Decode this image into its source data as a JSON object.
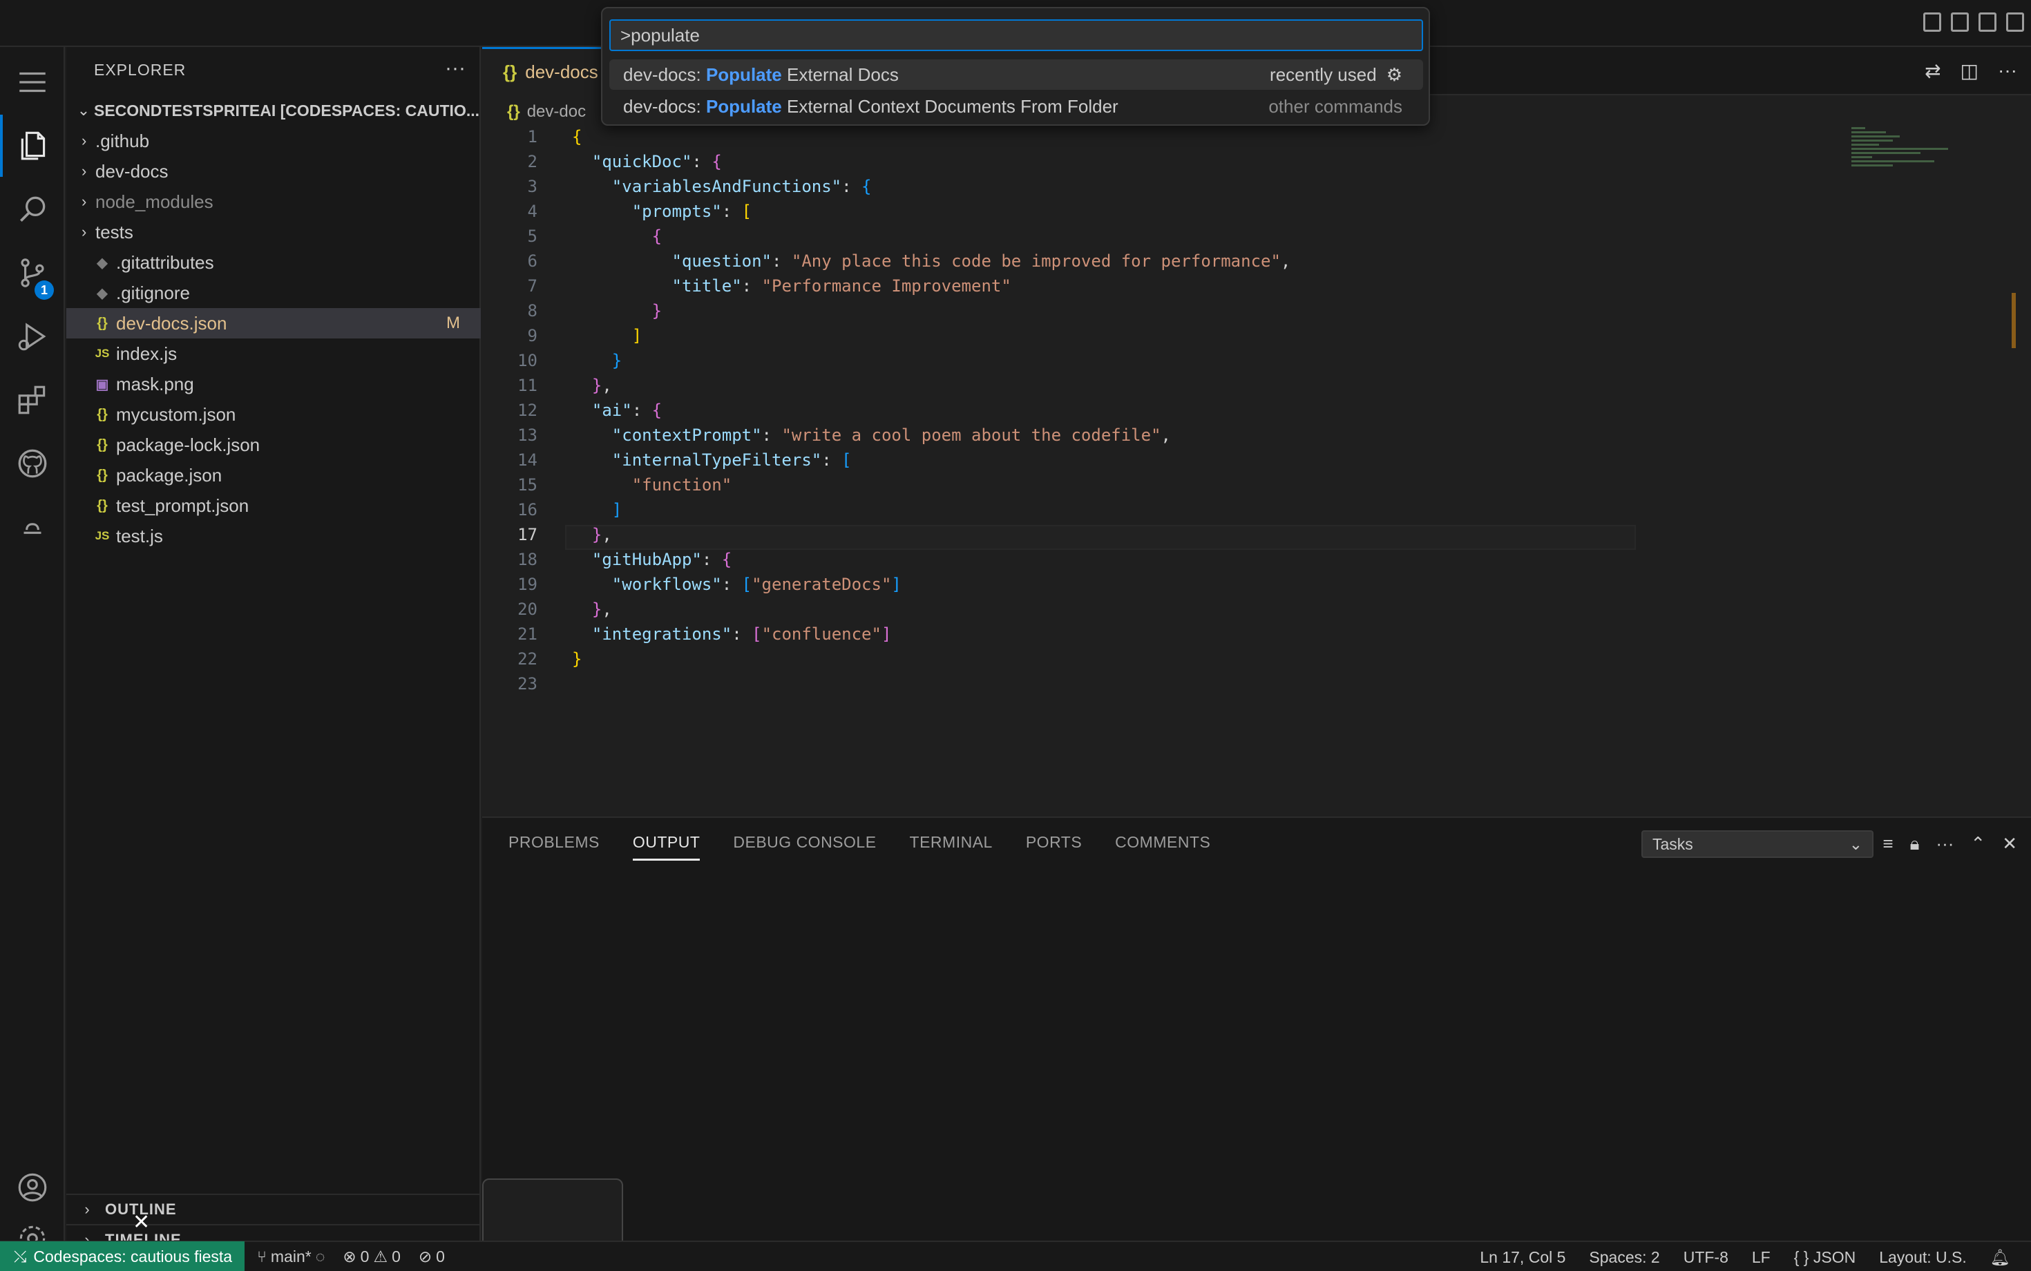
{
  "quick_input": {
    "value": ">populate",
    "items": [
      {
        "prefix": "dev-docs: ",
        "highlight": "Populate",
        "suffix": " External Docs",
        "detail": "recently used"
      },
      {
        "prefix": "dev-docs: ",
        "highlight": "Populate",
        "suffix": " External Context Documents From Folder",
        "detail": "other commands"
      }
    ]
  },
  "activity_bar": {
    "scm_badge": "1"
  },
  "sidebar": {
    "title": "EXPLORER",
    "more": "···",
    "workspace": "SECONDTESTSPRITEAI [CODESPACES: CAUTIO...",
    "folders": [
      ".github",
      "dev-docs",
      "node_modules",
      "tests"
    ],
    "files": [
      ".gitattributes",
      ".gitignore",
      "dev-docs.json",
      "index.js",
      "mask.png",
      "mycustom.json",
      "package-lock.json",
      "package.json",
      "test_prompt.json",
      "test.js"
    ],
    "modified_marker": "M",
    "outline": "OUTLINE",
    "timeline": "TIMELINE"
  },
  "editor": {
    "tab_label": "dev-docs",
    "breadcrumb": "dev-doc",
    "line_numbers": [
      "1",
      "2",
      "3",
      "4",
      "5",
      "6",
      "7",
      "8",
      "9",
      "10",
      "11",
      "12",
      "13",
      "14",
      "15",
      "16",
      "17",
      "18",
      "19",
      "20",
      "21",
      "22",
      "23"
    ]
  },
  "panel": {
    "tabs": [
      "PROBLEMS",
      "OUTPUT",
      "DEBUG CONSOLE",
      "TERMINAL",
      "PORTS",
      "COMMENTS"
    ],
    "active_tab": "OUTPUT",
    "output_channel": "Tasks"
  },
  "status_bar": {
    "remote": "Codespaces: cautious fiesta",
    "branch": "main*",
    "errors": "0",
    "warnings": "0",
    "ports": "0",
    "position": "Ln 17, Col 5",
    "spaces": "Spaces: 2",
    "encoding": "UTF-8",
    "eol": "LF",
    "language": "JSON",
    "layout": "Layout: U.S."
  },
  "icons": {
    "explorer": "files-icon",
    "search": "search-icon",
    "scm": "source-control-icon",
    "debug": "run-debug-icon",
    "extensions": "extensions-icon",
    "github": "github-icon",
    "accounts": "account-icon",
    "settings": "gear-icon"
  },
  "colors": {
    "accent": "#0078d4",
    "remote": "#16825d",
    "modified": "#e2c08d",
    "highlight": "#4d9cff"
  }
}
